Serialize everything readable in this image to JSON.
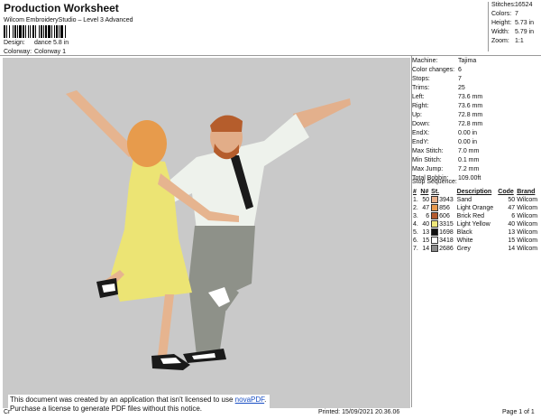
{
  "header": {
    "title": "Production Worksheet",
    "subtitle": "Wilcom EmbroideryStudio – Level 3 Advanced",
    "design_label": "Design:",
    "design_value": "dance 5.8 in",
    "colorway_label": "Colorway:",
    "colorway_value": "Colorway 1"
  },
  "summary": [
    {
      "label": "Stitches:",
      "value": "16524"
    },
    {
      "label": "Colors:",
      "value": "7"
    },
    {
      "label": "Height:",
      "value": "5.73 in"
    },
    {
      "label": "Width:",
      "value": "5.79 in"
    },
    {
      "label": "Zoom:",
      "value": "1:1"
    }
  ],
  "stats": [
    {
      "label": "Machine:",
      "value": "Tajima"
    },
    {
      "label": "Color changes:",
      "value": "6"
    },
    {
      "label": "Stops:",
      "value": "7"
    },
    {
      "label": "Trims:",
      "value": "25"
    },
    {
      "label": "Left:",
      "value": "73.6 mm"
    },
    {
      "label": "Right:",
      "value": "73.6 mm"
    },
    {
      "label": "Up:",
      "value": "72.8 mm"
    },
    {
      "label": "Down:",
      "value": "72.8 mm"
    },
    {
      "label": "EndX:",
      "value": "0.00 in"
    },
    {
      "label": "EndY:",
      "value": "0.00 in"
    },
    {
      "label": "Max Stitch:",
      "value": "7.0 mm"
    },
    {
      "label": "Min Stitch:",
      "value": "0.1 mm"
    },
    {
      "label": "Max Jump:",
      "value": "7.2 mm"
    },
    {
      "label": "Total Bobbin:",
      "value": "109.00ft"
    }
  ],
  "stop_sequence": {
    "title": "Stop Sequence:",
    "headers": [
      "#",
      "N#",
      "St.",
      "Description",
      "Code",
      "Brand"
    ],
    "rows": [
      {
        "idx": "1.",
        "n": "50",
        "st": "3943",
        "desc": "Sand",
        "code": "50",
        "brand": "Wilcom",
        "color": "#e8b08a"
      },
      {
        "idx": "2.",
        "n": "47",
        "st": "856",
        "desc": "Light Orange",
        "code": "47",
        "brand": "Wilcom",
        "color": "#e99a4e"
      },
      {
        "idx": "3.",
        "n": "6",
        "st": "606",
        "desc": "Brick Red",
        "code": "6",
        "brand": "Wilcom",
        "color": "#b35a2e"
      },
      {
        "idx": "4.",
        "n": "40",
        "st": "3315",
        "desc": "Light Yellow",
        "code": "40",
        "brand": "Wilcom",
        "color": "#efe77a"
      },
      {
        "idx": "5.",
        "n": "13",
        "st": "1698",
        "desc": "Black",
        "code": "13",
        "brand": "Wilcom",
        "color": "#111111"
      },
      {
        "idx": "6.",
        "n": "15",
        "st": "3418",
        "desc": "White",
        "code": "15",
        "brand": "Wilcom",
        "color": "#ffffff"
      },
      {
        "idx": "7.",
        "n": "14",
        "st": "2686",
        "desc": "Grey",
        "code": "14",
        "brand": "Wilcom",
        "color": "#8a8a8a"
      }
    ]
  },
  "notice": {
    "line1_prefix": "This document was created by an application that isn't licensed to use ",
    "link": "novaPDF",
    "line1_suffix": ".",
    "line2": "Purchase a license to generate PDF files without this notice."
  },
  "footer": {
    "left": "Cr",
    "printed": "Printed: 15/09/2021 20.36.06",
    "page": "Page 1 of 1"
  }
}
